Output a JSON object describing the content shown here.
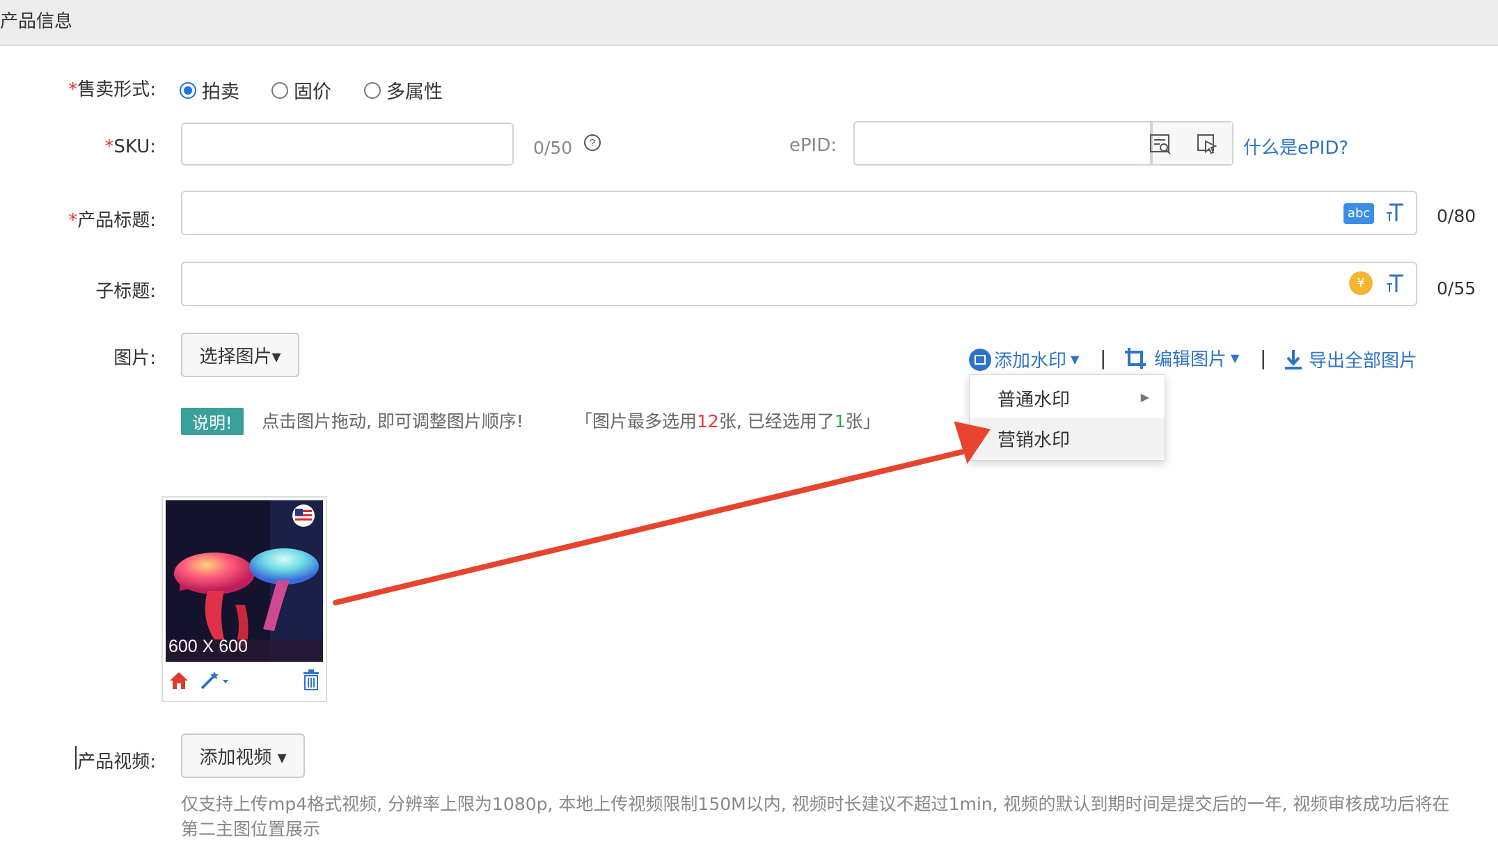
{
  "header": {
    "title": "产品信息"
  },
  "form": {
    "sale_type": {
      "label": "售卖形式:",
      "options": [
        "拍卖",
        "固价",
        "多属性"
      ],
      "selected": "拍卖"
    },
    "sku": {
      "label": "SKU:",
      "value": "",
      "counter": "0/50"
    },
    "epid": {
      "label": "ePID:",
      "value": "",
      "help_link": "什么是ePID?"
    },
    "title": {
      "label": "产品标题:",
      "value": "",
      "counter": "0/80",
      "abc_badge": "abc"
    },
    "subtitle": {
      "label": "子标题:",
      "value": "",
      "counter": "0/55",
      "coin_symbol": "¥"
    },
    "images": {
      "label": "图片:",
      "select_button": "选择图片▾",
      "toolbar": {
        "watermark": "添加水印",
        "edit": "编辑图片",
        "export": "导出全部图片"
      },
      "watermark_menu": {
        "items": [
          "普通水印",
          "营销水印"
        ]
      },
      "note": {
        "tag": "说明!",
        "text": "点击图片拖动, 即可调整图片顺序!",
        "limit_prefix": "「图片最多选用",
        "limit_max": "12",
        "limit_mid": "张, 已经选用了",
        "limit_used": "1",
        "limit_suffix": "张」"
      },
      "thumbnail": {
        "size_label": "600 X 600"
      }
    },
    "video": {
      "label": "产品视频:",
      "add_button": "添加视频 ▾",
      "hint": "仅支持上传mp4格式视频, 分辨率上限为1080p, 本地上传视频限制150M以内, 视频时长建议不超过1min, 视频的默认到期时间是提交后的一年, 视频审核成功后将在第二主图位置展示"
    }
  },
  "colors": {
    "accent": "#2e73c9",
    "required": "#e4393c",
    "note_tag": "#3aa19a",
    "arrow": "#e8442d"
  }
}
